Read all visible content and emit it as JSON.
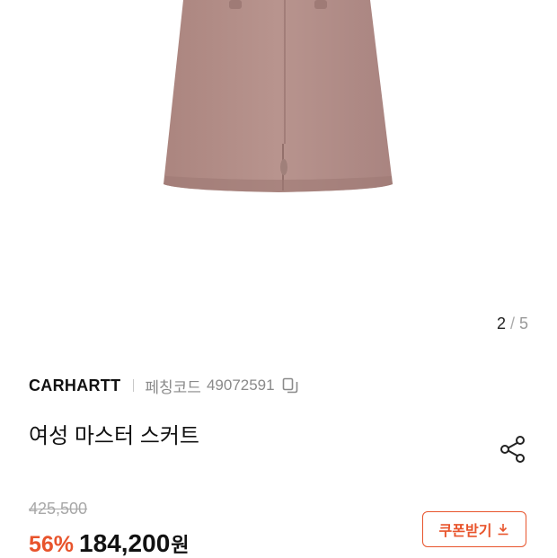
{
  "gallery": {
    "current": "2",
    "separator": "/",
    "total": "5"
  },
  "product": {
    "brand": "CARHARTT",
    "code_label": "페칭코드",
    "code": "49072591",
    "title": "여성 마스터 스커트",
    "original_price": "425,500",
    "discount": "56%",
    "price": "184,200",
    "currency": "원"
  },
  "actions": {
    "coupon_label": "쿠폰받기"
  },
  "colors": {
    "accent": "#e8542c",
    "skirt": "#b48f89"
  },
  "icons": [
    "copy-icon",
    "share-icon",
    "download-icon"
  ]
}
